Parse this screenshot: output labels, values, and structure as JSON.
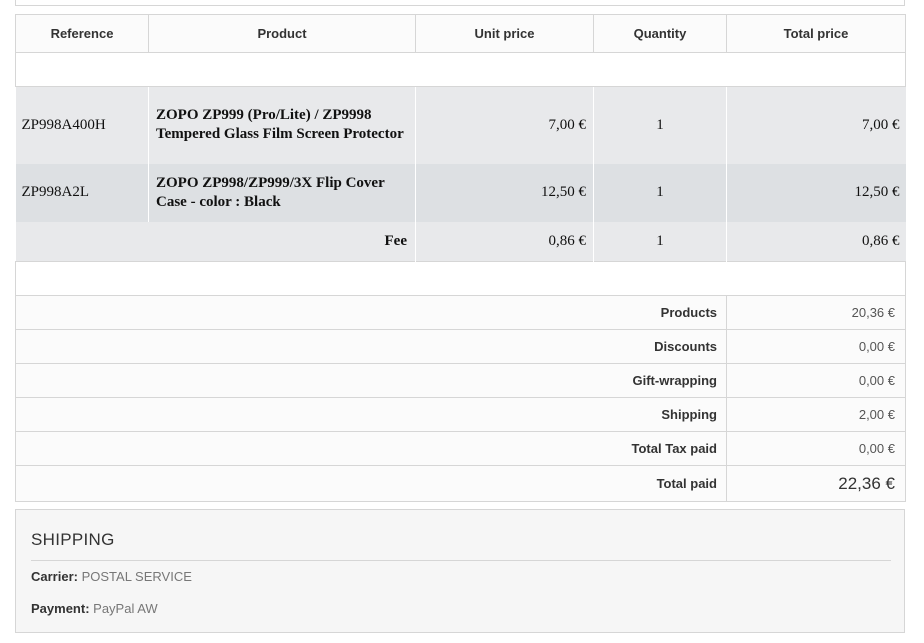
{
  "table": {
    "headers": [
      "Reference",
      "Product",
      "Unit price",
      "Quantity",
      "Total price"
    ],
    "items": [
      {
        "reference": "ZP998A400H",
        "product": "ZOPO ZP999 (Pro/Lite) / ZP9998 Tempered Glass Film Screen Protector",
        "unit_price": "7,00 €",
        "quantity": "1",
        "total_price": "7,00 €"
      },
      {
        "reference": "ZP998A2L",
        "product": "ZOPO ZP998/ZP999/3X Flip Cover Case - color : Black",
        "unit_price": "12,50 €",
        "quantity": "1",
        "total_price": "12,50 €"
      }
    ],
    "fee": {
      "label": "Fee",
      "unit_price": "0,86 €",
      "quantity": "1",
      "total_price": "0,86 €"
    }
  },
  "totals": {
    "products": {
      "label": "Products",
      "value": "20,36 €"
    },
    "discounts": {
      "label": "Discounts",
      "value": "0,00 €"
    },
    "gift_wrapping": {
      "label": "Gift-wrapping",
      "value": "0,00 €"
    },
    "shipping": {
      "label": "Shipping",
      "value": "2,00 €"
    },
    "tax": {
      "label": "Total Tax paid",
      "value": "0,00 €"
    },
    "total_paid": {
      "label": "Total paid",
      "value": "22,36 €"
    }
  },
  "shipping_section": {
    "title": "SHIPPING",
    "carrier_label": "Carrier:",
    "carrier_value": "POSTAL SERVICE",
    "payment_label": "Payment:",
    "payment_value": "PayPal AW"
  }
}
